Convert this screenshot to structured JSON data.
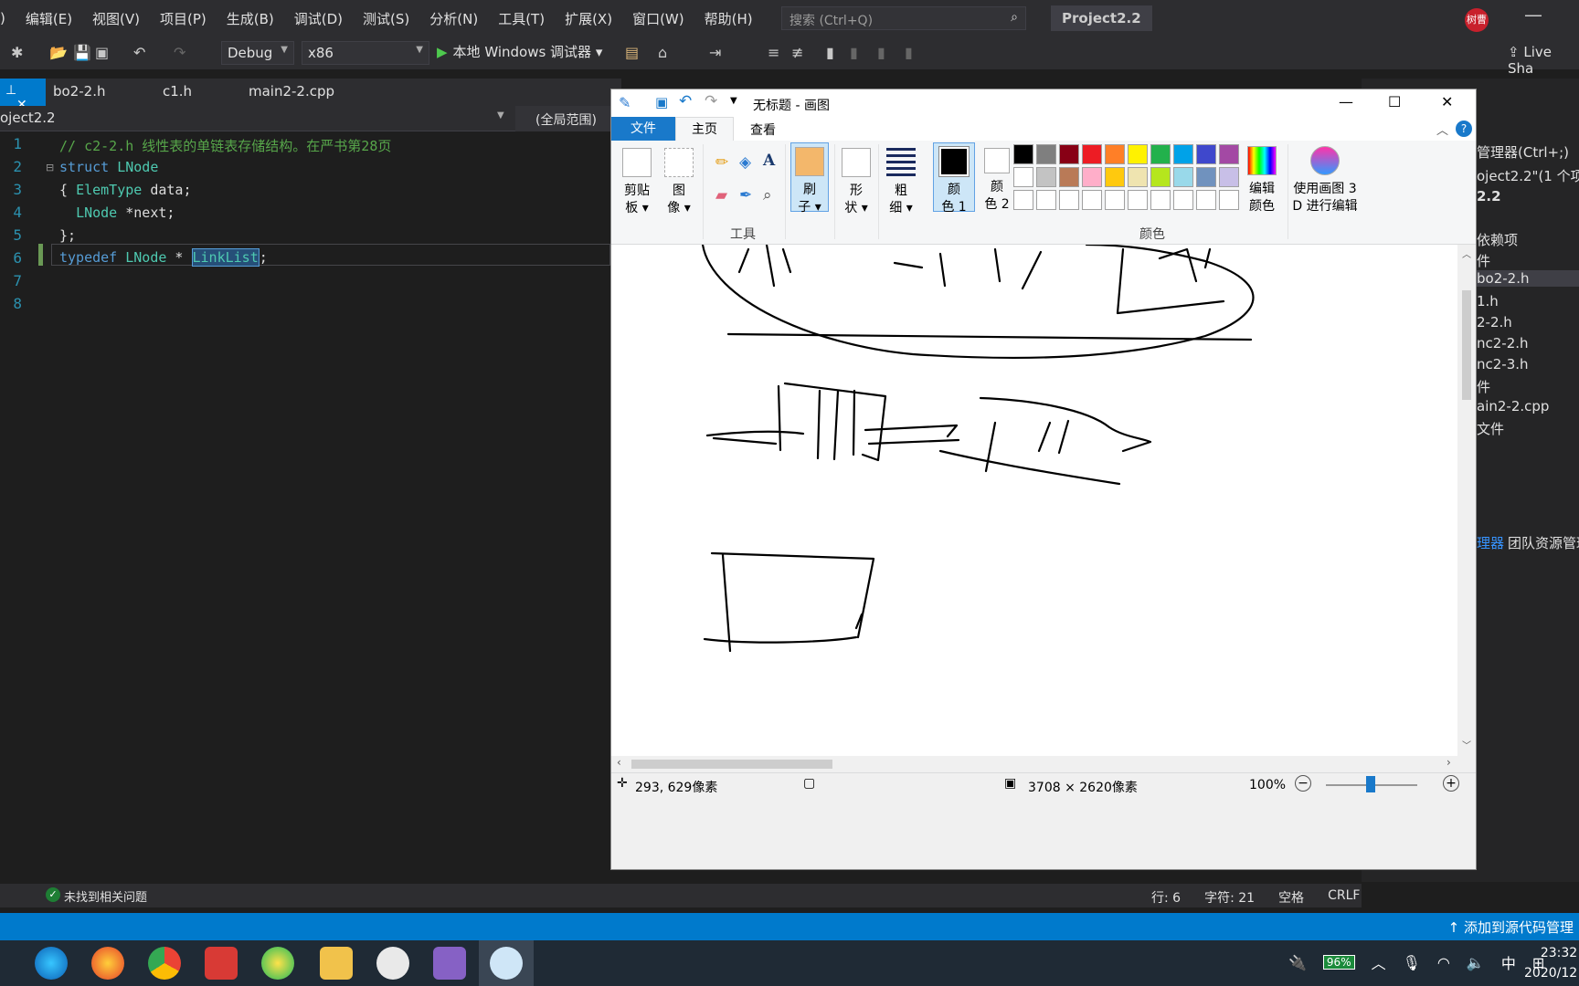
{
  "vs": {
    "menu": [
      ")",
      "编辑(E)",
      "视图(V)",
      "项目(P)",
      "生成(B)",
      "调试(D)",
      "测试(S)",
      "分析(N)",
      "工具(T)",
      "扩展(X)",
      "窗口(W)",
      "帮助(H)"
    ],
    "search_placeholder": "搜索 (Ctrl+Q)",
    "project_title": "Project2.2",
    "avatar": "树曹",
    "config": "Debug",
    "platform": "x86",
    "debugger": "本地 Windows 调试器",
    "live_share": "Live Sha",
    "tabs": [
      "bo2-2.h",
      "c1.h",
      "main2-2.cpp"
    ],
    "nav_project": "oject2.2",
    "nav_scope": "(全局范围)",
    "lines": [
      "1",
      "2",
      "3",
      "4",
      "5",
      "6",
      "7",
      "8"
    ],
    "code": {
      "l1": "// c2-2.h 线性表的单链表存储结构。在严书第28页",
      "l2_kw": "struct",
      "l2_ty": " LNode",
      "l3a": "{ ",
      "l3_ty": "ElemType",
      "l3b": " data;",
      "l4a": "  ",
      "l4_ty": "LNode",
      "l4b": " *next;",
      "l5": "};",
      "l6_kw": "typedef",
      "l6_ty": " LNode",
      "l6b": " * ",
      "l6_sel": "LinkList",
      "l6c": ";"
    },
    "error_status": "未找到相关问题",
    "line_info": "行: 6",
    "char_info": "字符: 21",
    "space_info": "空格",
    "eol_info": "CRLF",
    "source_control": "添加到源代码管理",
    "solution": {
      "header": "管理器(Ctrl+;)",
      "root": "oject2.2\"(1 个项",
      "proj": "2.2",
      "items": [
        "依赖项",
        "件",
        "bo2-2.h",
        "1.h",
        "2-2.h",
        "nc2-2.h",
        "nc2-3.h",
        "件",
        "ain2-2.cpp",
        "文件"
      ],
      "tabs": [
        "理器",
        "团队资源管理"
      ]
    }
  },
  "paint": {
    "title": "无标题 - 画图",
    "tab_file": "文件",
    "tab_home": "主页",
    "tab_view": "查看",
    "clipboard": [
      "剪贴",
      "板"
    ],
    "image": [
      "图",
      "像"
    ],
    "tools_label": "工具",
    "brush": [
      "刷",
      "子"
    ],
    "shapes": [
      "形",
      "状"
    ],
    "size": [
      "粗",
      "细"
    ],
    "color1": [
      "颜",
      "色 1"
    ],
    "color2": [
      "颜",
      "色 2"
    ],
    "edit_colors": [
      "编辑",
      "颜色"
    ],
    "paint3d": [
      "使用画图 3",
      "D 进行编辑"
    ],
    "colors_label": "颜色",
    "palette_row1": [
      "#000000",
      "#7f7f7f",
      "#880015",
      "#ed1c24",
      "#ff7f27",
      "#fff200",
      "#22b14c",
      "#00a2e8",
      "#3f48cc",
      "#a349a4"
    ],
    "palette_row2": [
      "#ffffff",
      "#c3c3c3",
      "#b97a57",
      "#ffaec9",
      "#ffc90e",
      "#efe4b0",
      "#b5e61d",
      "#99d9ea",
      "#7092be",
      "#c8bfe7"
    ],
    "coords": "293, 629像素",
    "dims": "3708 × 2620像素",
    "zoom": "100%"
  },
  "taskbar": {
    "battery": "96%",
    "ime": "中",
    "time": "23:32",
    "date": "2020/12"
  }
}
